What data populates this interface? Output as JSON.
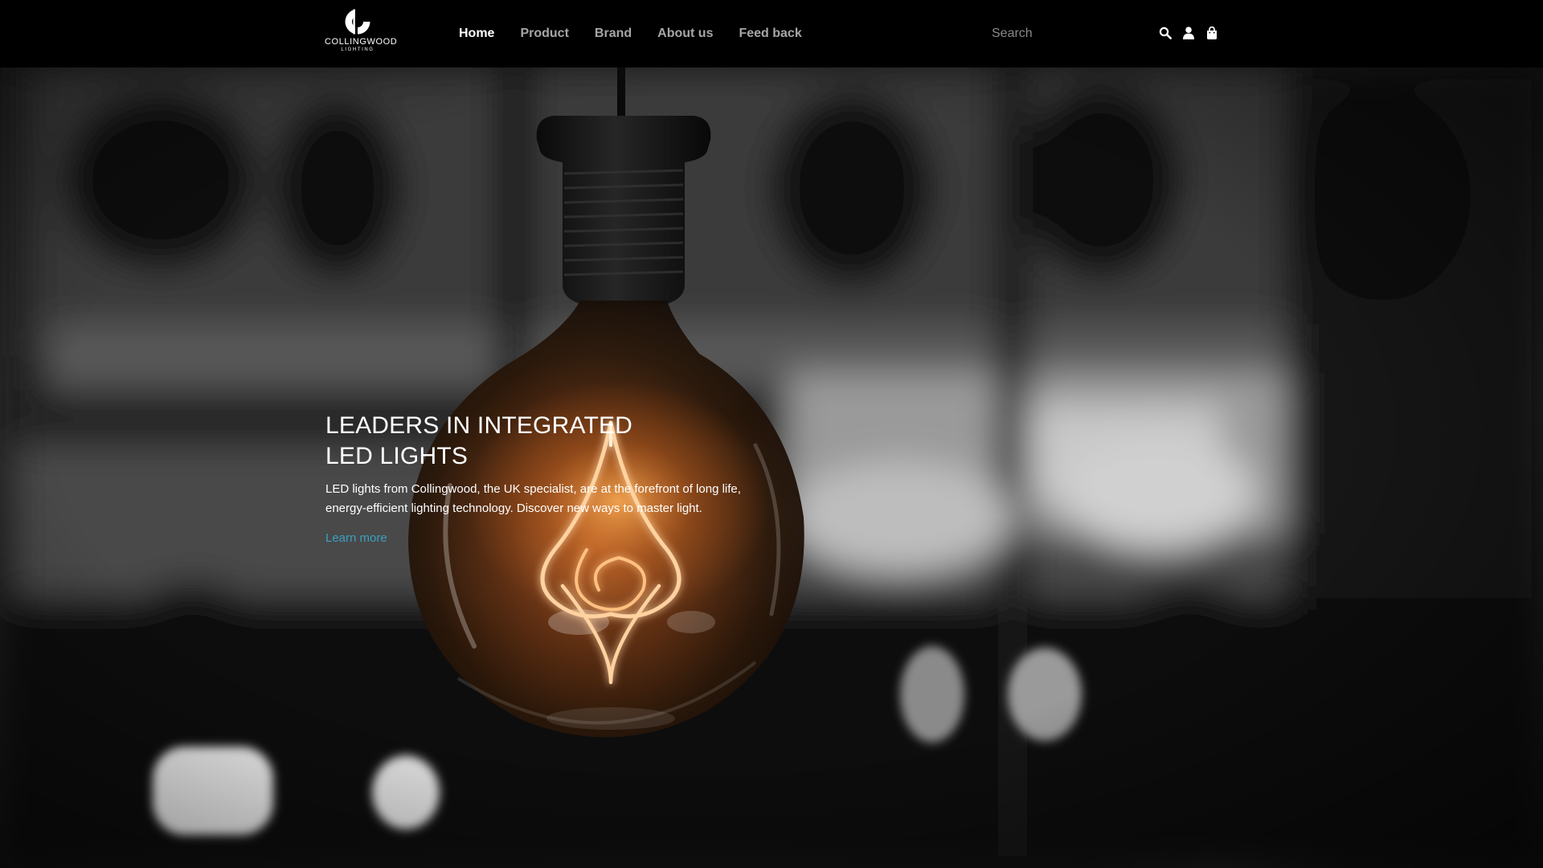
{
  "brand": {
    "name": "COLLINGWOOD",
    "tagline": "LIGHTING"
  },
  "nav": {
    "items": [
      {
        "label": "Home",
        "active": true
      },
      {
        "label": "Product",
        "active": false
      },
      {
        "label": "Brand",
        "active": false
      },
      {
        "label": "About us",
        "active": false
      },
      {
        "label": "Feed back",
        "active": false
      }
    ]
  },
  "search": {
    "placeholder": "Search",
    "value": ""
  },
  "icons": {
    "search": "search-icon",
    "account": "user-icon",
    "cart": "shopping-bag-icon"
  },
  "hero": {
    "title_line1": "LEADERS IN INTEGRATED",
    "title_line2": "LED LIGHTS",
    "text": "LED lights from Collingwood, the UK specialist, are at the forefront of long life, energy-efficient lighting technology. Discover new ways to master light.",
    "link_label": "Learn more"
  },
  "colors": {
    "nav_background": "#000000",
    "nav_active": "#ffffff",
    "nav_inactive": "#a6a6a6",
    "link_accent": "#3aa0c4",
    "filament_glow": "#ff9a3c"
  }
}
